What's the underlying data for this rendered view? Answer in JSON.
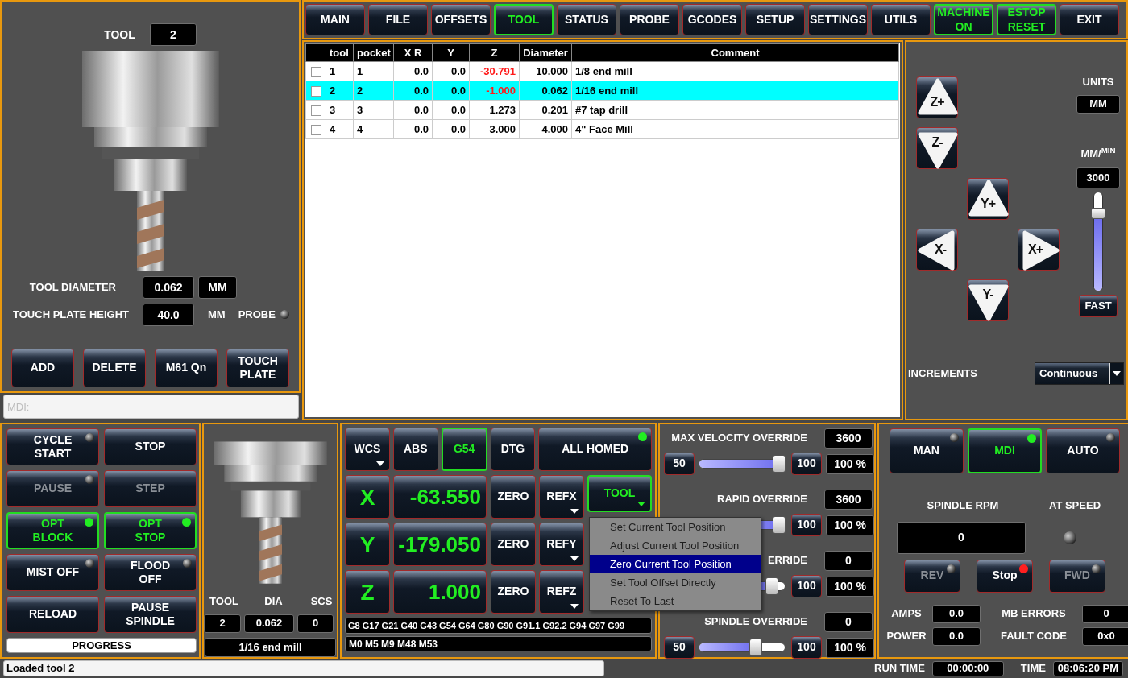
{
  "nav": [
    {
      "kind": "tab",
      "label": "MAIN",
      "selected": false
    },
    {
      "kind": "tab",
      "label": "FILE",
      "selected": false
    },
    {
      "kind": "tab",
      "label": "OFFSETS",
      "selected": false
    },
    {
      "kind": "tab",
      "label": "TOOL",
      "selected": true
    },
    {
      "kind": "tab",
      "label": "STATUS",
      "selected": false
    },
    {
      "kind": "tab",
      "label": "PROBE",
      "selected": false
    },
    {
      "kind": "tab",
      "label": "GCODES",
      "selected": false
    },
    {
      "kind": "tab",
      "label": "SETUP",
      "selected": false
    },
    {
      "kind": "tab",
      "label": "SETTINGS",
      "selected": false
    },
    {
      "kind": "tab",
      "label": "UTILS",
      "selected": false
    },
    {
      "kind": "toggle",
      "label": "MACHINE ON",
      "on": true
    },
    {
      "kind": "toggle",
      "label": "ESTOP RESET",
      "on": true
    },
    {
      "kind": "tab",
      "label": "EXIT",
      "selected": false
    }
  ],
  "tool_panel": {
    "tool_label": "TOOL",
    "tool_value": "2",
    "diameter_label": "TOOL DIAMETER",
    "diameter_value": "0.062",
    "diameter_units": "MM",
    "plate_label": "TOUCH PLATE HEIGHT",
    "plate_value": "40.0",
    "plate_units": "MM",
    "probe_label": "PROBE",
    "probe_lit": false,
    "buttons": [
      "ADD",
      "DELETE",
      "M61 Qn",
      "TOUCH PLATE"
    ]
  },
  "mdi": {
    "placeholder": "MDI:"
  },
  "tool_table": {
    "columns": [
      "tool",
      "pocket",
      "X R",
      "Y",
      "Z",
      "Diameter",
      "Comment"
    ],
    "rows": [
      {
        "checked": false,
        "selected": false,
        "cells": [
          "1",
          "1",
          "0.0",
          "0.0",
          "-30.791",
          "10.000",
          "1/8 end mill"
        ],
        "z_alert": true
      },
      {
        "checked": false,
        "selected": true,
        "cells": [
          "2",
          "2",
          "0.0",
          "0.0",
          "-1.000",
          "0.062",
          "1/16 end mill"
        ],
        "z_alert": true
      },
      {
        "checked": false,
        "selected": false,
        "cells": [
          "3",
          "3",
          "0.0",
          "0.0",
          "1.273",
          "0.201",
          "#7 tap drill"
        ],
        "z_alert": false
      },
      {
        "checked": false,
        "selected": false,
        "cells": [
          "4",
          "4",
          "0.0",
          "0.0",
          "3.000",
          "4.000",
          "4\" Face Mill"
        ],
        "z_alert": false
      }
    ]
  },
  "jog": {
    "buttons": [
      {
        "kind": "z_up",
        "label": "Z+"
      },
      {
        "kind": "z_down",
        "label": "Z-"
      },
      {
        "kind": "y_up",
        "label": "Y+"
      },
      {
        "kind": "x_left",
        "label": "X-"
      },
      {
        "kind": "x_right",
        "label": "X+"
      },
      {
        "kind": "y_down",
        "label": "Y-"
      }
    ],
    "units_label": "UNITS",
    "units": "MM",
    "rate_label": "MM/$^{MIN}$",
    "rate": "3000",
    "rate_slider": {
      "level": 0.78
    },
    "fast_button": "FAST",
    "increments_label": "INCREMENTS",
    "increments": "Continuous"
  },
  "program_buttons": [
    {
      "label": "CYCLE START",
      "lit": false,
      "active": false,
      "disabled": false
    },
    {
      "label": "STOP",
      "active": false,
      "disabled": false
    },
    {
      "label": "PAUSE",
      "lit": false,
      "active": false,
      "disabled": true
    },
    {
      "label": "STEP",
      "active": false,
      "disabled": true
    },
    {
      "label": "OPT BLOCK",
      "lit": true,
      "color": "#22ee22",
      "active": true,
      "disabled": false
    },
    {
      "label": "OPT STOP",
      "lit": true,
      "color": "#22ee22",
      "active": true,
      "disabled": false
    },
    {
      "label": "MIST OFF",
      "lit": false,
      "active": false,
      "disabled": false
    },
    {
      "label": "FLOOD OFF",
      "lit": false,
      "active": false,
      "disabled": false
    },
    {
      "label": "RELOAD",
      "active": false,
      "disabled": false
    },
    {
      "label": "PAUSE SPINDLE",
      "active": false,
      "disabled": false
    }
  ],
  "progress": {
    "label": "PROGRESS",
    "level": 0
  },
  "tool_info": {
    "labels": [
      "TOOL",
      "DIA",
      "SCS"
    ],
    "values": [
      "2",
      "0.062",
      "0"
    ],
    "comment": "1/16 end mill"
  },
  "dro": {
    "modes": [
      {
        "label": "WCS",
        "selected": false,
        "dropdown": true
      },
      {
        "label": "ABS",
        "selected": false
      },
      {
        "label": "G54",
        "selected": true
      },
      {
        "label": "DTG",
        "selected": false
      },
      {
        "label": "ALL HOMED",
        "selected": false,
        "lit": true,
        "color": "#22ee22"
      }
    ],
    "axes": [
      {
        "axis": "X",
        "value": "-63.550",
        "zero": "ZERO",
        "ref": "REFX"
      },
      {
        "axis": "Y",
        "value": "-179.050",
        "zero": "ZERO",
        "ref": "REFY"
      },
      {
        "axis": "Z",
        "value": "1.000",
        "zero": "ZERO",
        "ref": "REFZ"
      }
    ],
    "tool_button": {
      "label": "TOOL",
      "active": true
    },
    "menu": [
      {
        "label": "Set Current Tool Position",
        "selected": false
      },
      {
        "label": "Adjust Current Tool Position",
        "selected": false
      },
      {
        "label": "Zero Current Tool Position",
        "selected": true
      },
      {
        "label": "Set Tool Offset Directly",
        "selected": false
      },
      {
        "label": "Reset To Last",
        "selected": false
      }
    ],
    "gcodes": "G8 G17 G21 G40 G43 G54 G64 G80 G90 G91.1 G92.2 G94 G97 G99",
    "mcodes": "M0 M5 M9 M48 M53"
  },
  "overrides": [
    {
      "label": "MAX VELOCITY OVERRIDE",
      "value": "3600",
      "min": "50",
      "max": "100",
      "level": 1,
      "percent": "100 %"
    },
    {
      "label": "RAPID OVERRIDE",
      "value": "3600",
      "max": "100",
      "level": 1,
      "percent": "100 %"
    },
    {
      "label": "ERRIDE",
      "value": "0",
      "max": "100",
      "level": 0.9,
      "percent": "100 %"
    },
    {
      "label": "SPINDLE OVERRIDE",
      "value": "0",
      "min": "50",
      "max": "100",
      "level": 0.68,
      "percent": "100 %"
    }
  ],
  "spindle": {
    "modes": [
      {
        "label": "MAN",
        "lit": false,
        "selected": false
      },
      {
        "label": "MDI",
        "lit": true,
        "color": "#22ee22",
        "selected": true
      },
      {
        "label": "AUTO",
        "lit": false,
        "selected": false
      }
    ],
    "rpm_label": "SPINDLE RPM",
    "at_speed_label": "AT SPEED",
    "rpm": "0",
    "at_speed_lit": false,
    "buttons": [
      {
        "label": "REV",
        "lit": false,
        "disabled": true
      },
      {
        "label": "Stop",
        "lit": true,
        "color": "#ff2020",
        "disabled": false
      },
      {
        "label": "FWD",
        "lit": false,
        "disabled": true
      }
    ],
    "stats": [
      {
        "label": "AMPS",
        "value": "0.0"
      },
      {
        "label": "MB ERRORS",
        "value": "0"
      },
      {
        "label": "POWER",
        "value": "0.0"
      },
      {
        "label": "FAULT CODE",
        "value": "0x0"
      }
    ]
  },
  "status_bar": {
    "message": "Loaded tool 2",
    "run_time_label": "RUN TIME",
    "run_time": "00:00:00",
    "time_label": "TIME",
    "time": "08:06:20 PM"
  }
}
